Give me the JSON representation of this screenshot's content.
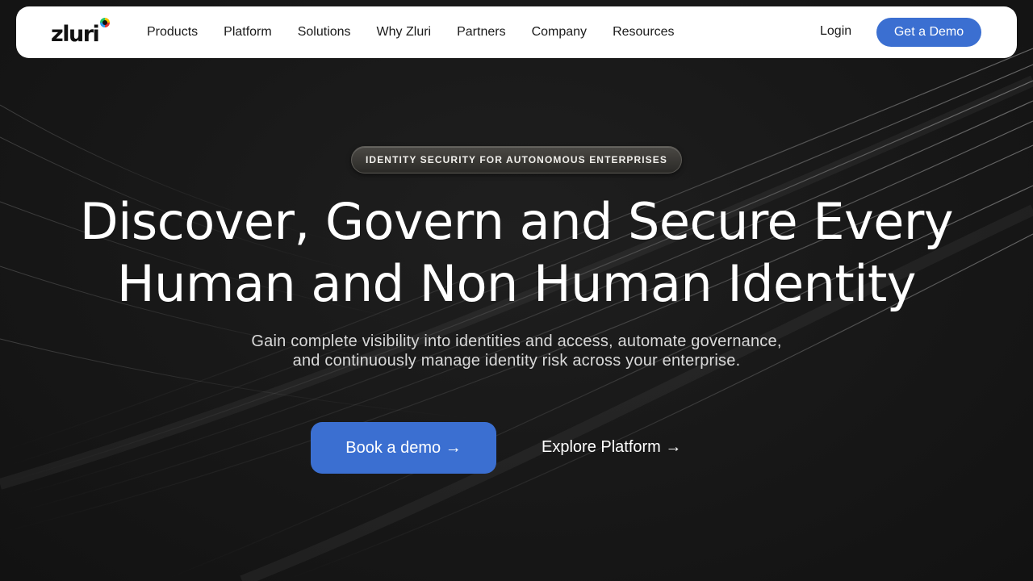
{
  "brand": {
    "logo_text": "zluri",
    "logo_colors": [
      "#f2c200",
      "#e3342f",
      "#2d9bf0",
      "#20c46a"
    ]
  },
  "nav": {
    "items": [
      {
        "label": "Products"
      },
      {
        "label": "Platform"
      },
      {
        "label": "Solutions"
      },
      {
        "label": "Why Zluri"
      },
      {
        "label": "Partners"
      },
      {
        "label": "Company"
      },
      {
        "label": "Resources"
      }
    ],
    "login_label": "Login",
    "demo_label": "Get a Demo"
  },
  "hero": {
    "badge": "IDENTITY SECURITY FOR AUTONOMOUS ENTERPRISES",
    "headline_line1": "Discover, Govern and Secure Every",
    "headline_line2": "Human and Non Human Identity",
    "subtitle_line1": "Gain complete visibility into identities and access, automate governance,",
    "subtitle_line2": "and continuously manage identity risk across your enterprise.",
    "primary_cta": "Book a demo →",
    "secondary_cta": "Explore Platform →"
  },
  "colors": {
    "accent": "#3b6fd1",
    "background": "#161616",
    "nav_background": "#ffffff"
  }
}
